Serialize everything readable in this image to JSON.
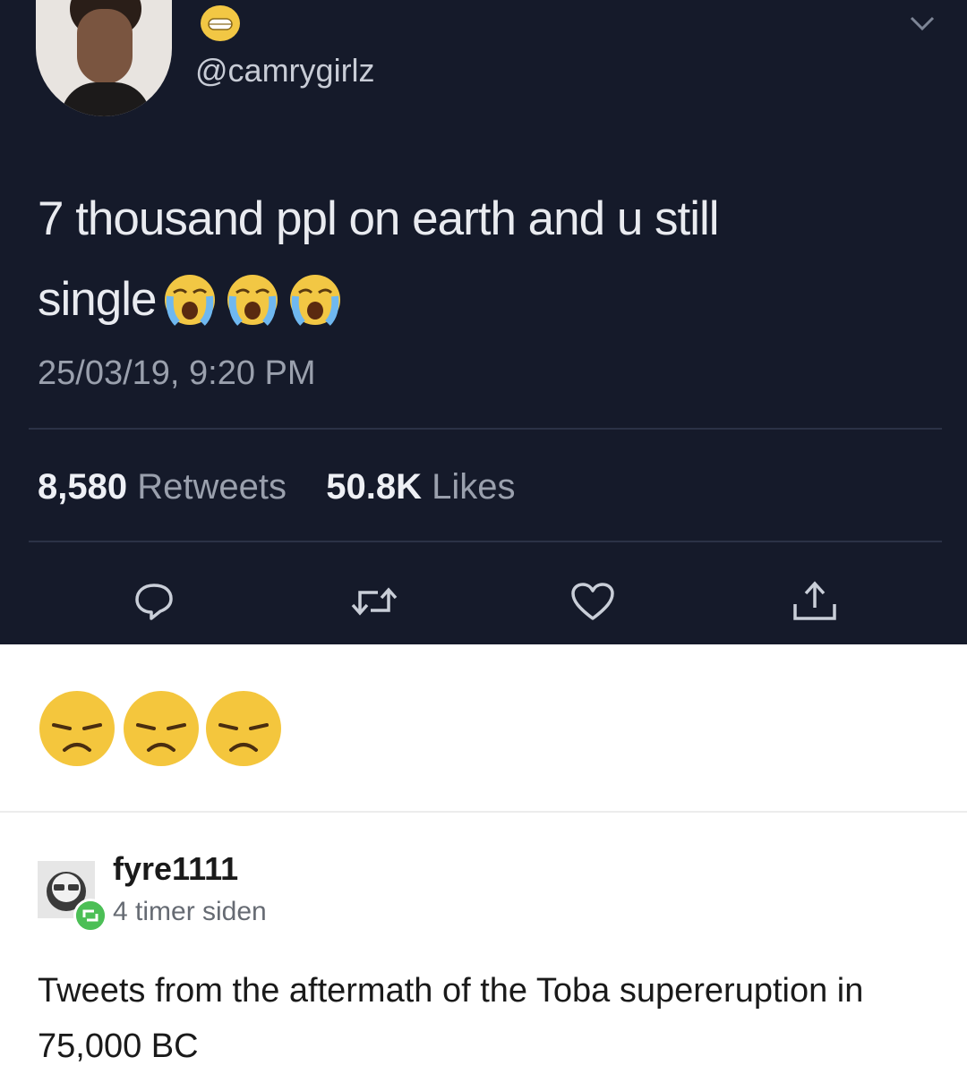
{
  "tweet": {
    "handle": "@camrygirlz",
    "text_line1": "7 thousand ppl on earth and u still",
    "text_line2": "single",
    "timestamp": "25/03/19, 9:20 PM",
    "retweets_count": "8,580",
    "retweets_label": "Retweets",
    "likes_count": "50.8K",
    "likes_label": "Likes",
    "background": "#151a2a"
  },
  "reaction": {
    "emojis": [
      "disappointed-face",
      "disappointed-face",
      "disappointed-face"
    ]
  },
  "post": {
    "username": "fyre1111",
    "time_ago": "4 timer siden",
    "text": "Tweets from the aftermath of the Toba supereruption in 75,000 BC"
  }
}
